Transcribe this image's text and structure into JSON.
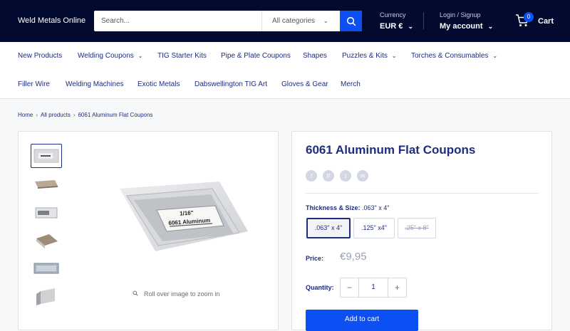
{
  "header": {
    "logo": "Weld Metals Online",
    "search_placeholder": "Search...",
    "category_select": "All categories",
    "currency_caption": "Currency",
    "currency_value": "EUR €",
    "login_caption": "Login / Signup",
    "account_label": "My account",
    "cart_count": "0",
    "cart_label": "Cart"
  },
  "nav": {
    "items": [
      {
        "label": "New Products"
      },
      {
        "label": "Welding Coupons"
      },
      {
        "label": "TIG Starter Kits"
      },
      {
        "label": "Pipe & Plate Coupons"
      },
      {
        "label": "Shapes"
      },
      {
        "label": "Puzzles & Kits"
      },
      {
        "label": "Torches & Consumables"
      },
      {
        "label": "Filler Wire"
      },
      {
        "label": "Welding Machines"
      },
      {
        "label": "Exotic Metals"
      },
      {
        "label": "Dabswellington TIG Art"
      },
      {
        "label": "Gloves & Gear"
      },
      {
        "label": "Merch"
      }
    ]
  },
  "breadcrumb": {
    "home": "Home",
    "all": "All products",
    "current": "6061 Aluminum Flat Coupons"
  },
  "gallery": {
    "zoom_hint": "Roll over image to zoom in",
    "label_size": "1/16\"",
    "label_material": "6061 Aluminum"
  },
  "product": {
    "title": "6061 Aluminum Flat Coupons",
    "option_caption": "Thickness & Size:",
    "option_selected": ".063\" x 4\"",
    "options": [
      {
        "label": ".063\" x 4\""
      },
      {
        "label": ".125\" x4\""
      },
      {
        "label": ".25\" x 8\""
      }
    ],
    "price_label": "Price:",
    "price": "€9,95",
    "quantity_label": "Quantity:",
    "quantity": "1",
    "add_to_cart": "Add to cart"
  },
  "colors": {
    "header_bg": "#020b2f",
    "accent": "#0c4ff2",
    "text": "#1e2d7d"
  }
}
